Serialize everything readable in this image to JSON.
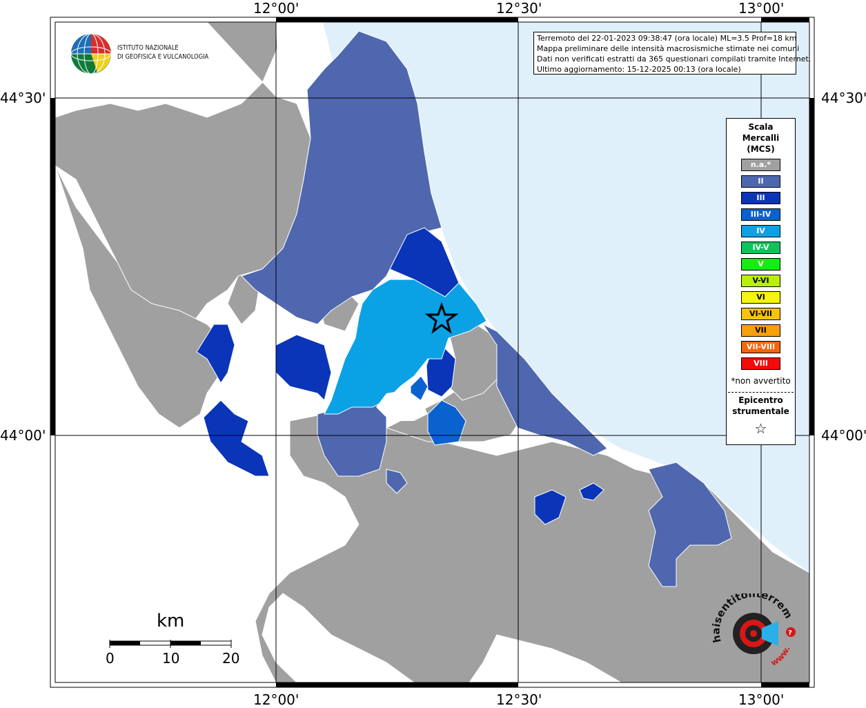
{
  "coords": {
    "top": [
      "12°00'",
      "12°30'",
      "13°00'"
    ],
    "bottom": [
      "12°00'",
      "12°30'",
      "13°00'"
    ],
    "left": [
      "44°30'",
      "44°00'"
    ],
    "right": [
      "44°30'",
      "44°00'"
    ]
  },
  "info": {
    "line1": "Terremoto del 22-01-2023 09:38:47 (ora locale) ML=3.5 Prof=18 km",
    "line2": "Mappa preliminare delle intensità macrosismiche stimate nei comuni",
    "line3": "Dati non verificati estratti da 365 questionari compilati tramite Internet.",
    "line4": "Ultimo aggiornamento: 15-12-2025 00:13 (ora locale)"
  },
  "logo": {
    "line1": "ISTITUTO NAZIONALE",
    "line2": "DI GEOFISICA E VULCANOLOGIA"
  },
  "legend": {
    "title1": "Scala",
    "title2": "Mercalli",
    "title3": "(MCS)",
    "classes": [
      {
        "label": "n.a.*",
        "color": "#a0a0a0"
      },
      {
        "label": "II",
        "color": "#4e67ae"
      },
      {
        "label": "III",
        "color": "#0a35b8"
      },
      {
        "label": "III-IV",
        "color": "#0a62cf"
      },
      {
        "label": "IV",
        "color": "#0aa2e4"
      },
      {
        "label": "IV-V",
        "color": "#0dc45b"
      },
      {
        "label": "V",
        "color": "#14ec14"
      },
      {
        "label": "V-VI",
        "color": "#b8f00a"
      },
      {
        "label": "VI",
        "color": "#f5f50a"
      },
      {
        "label": "VI-VII",
        "color": "#f5c30a"
      },
      {
        "label": "VII",
        "color": "#f5a00a"
      },
      {
        "label": "VII-VIII",
        "color": "#f5640a"
      },
      {
        "label": "VIII",
        "color": "#f50a0a"
      }
    ],
    "note": "*non avvertito",
    "epi1": "Epicentro",
    "epi2": "strumentale"
  },
  "scalebar": {
    "unit": "km",
    "ticks": [
      "0",
      "10",
      "20"
    ]
  },
  "hai_logo": {
    "text": "haisentitoilterremoto.it",
    "url_text": "www."
  },
  "colors": {
    "sea": "#dff0fb",
    "land_na": "#a0a0a0",
    "II": "#4e67ae",
    "III": "#0a35b8",
    "III-IV": "#0a62cf",
    "IV": "#0aa2e4"
  }
}
